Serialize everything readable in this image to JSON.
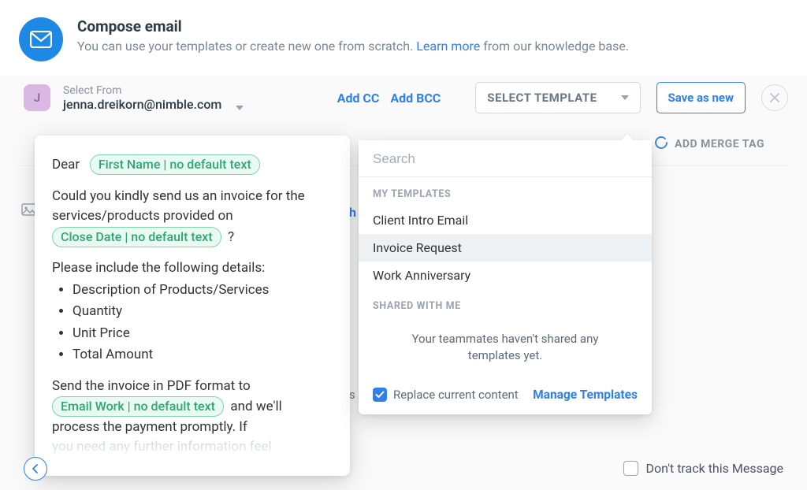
{
  "header": {
    "title": "Compose email",
    "subtitle_before": "You can use your templates or create new one from scratch. ",
    "learn_more": "Learn more",
    "subtitle_after": " from our knowledge base."
  },
  "from": {
    "avatar_initial": "J",
    "label": "Select From",
    "email": "jenna.dreikorn@nimble.com"
  },
  "actions": {
    "add_cc": "Add CC",
    "add_bcc": "Add BCC",
    "select_template": "SELECT TEMPLATE",
    "save_as_new": "Save as new",
    "add_merge_tag": "ADD MERGE TAG"
  },
  "body": {
    "greeting": "Dear",
    "merge_first_name": "First Name | no default text",
    "line1": "Could you kindly send us an invoice for the services/products provided on",
    "merge_close_date": "Close Date | no default text",
    "question_mark": "?",
    "details_intro": "Please include the following details:",
    "bullets": [
      "Description of Products/Services",
      "Quantity",
      "Unit Price",
      "Total Amount"
    ],
    "line3a": "Send the invoice in PDF format to",
    "merge_email_work": "Email Work | no default text",
    "line3b": "and we'll process the payment promptly. If",
    "faded": "you need any further information  feel"
  },
  "templates": {
    "search_placeholder": "Search",
    "section_my": "MY TEMPLATES",
    "items": [
      "Client Intro Email",
      "Invoice Request",
      "Work Anniversary"
    ],
    "section_shared": "SHARED WITH ME",
    "shared_empty": "Your teammates haven't shared any templates yet.",
    "replace_label": "Replace current content",
    "manage": "Manage Templates"
  },
  "footer": {
    "dont_track": "Don't track this Message"
  },
  "hidden": {
    "h": "h",
    "s": "s"
  }
}
